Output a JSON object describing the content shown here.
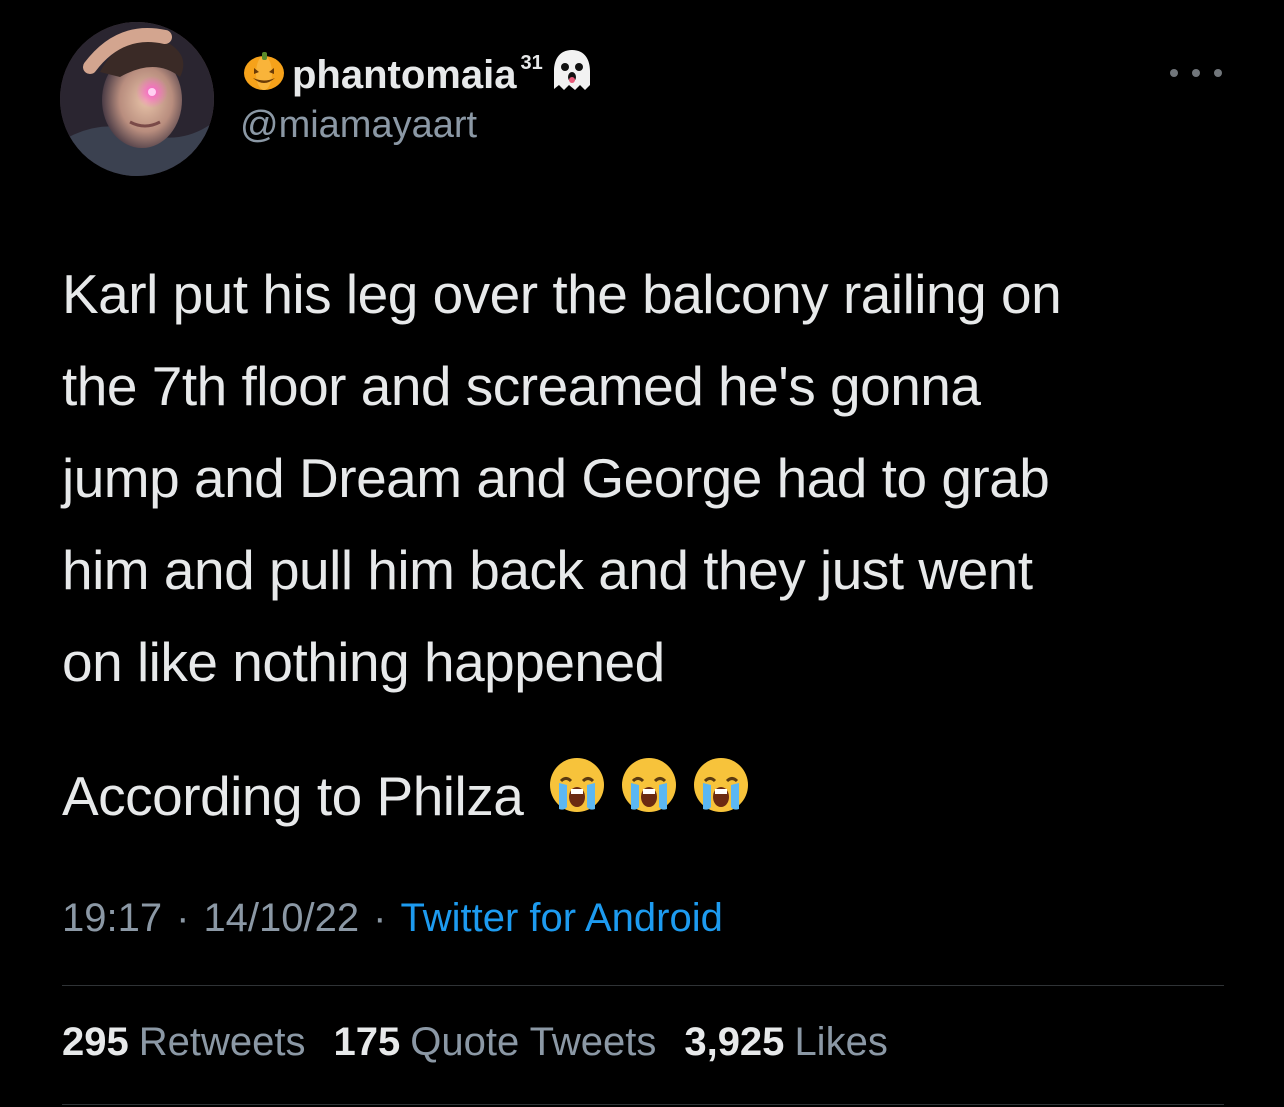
{
  "user": {
    "display_name": "phantomaia",
    "display_name_sup": "31",
    "handle": "@miamayaart",
    "name_prefix_icon": "pumpkin-icon",
    "name_suffix_icon": "ghost-icon"
  },
  "tweet": {
    "text_lines": [
      "Karl put his leg over the balcony railing on",
      "the 7th floor and screamed he's gonna",
      "jump and Dream and George had to grab",
      "him and pull him back and they just went",
      "on like nothing happened"
    ],
    "second_paragraph": "According to Philza",
    "emoji_icons": [
      "crying-face-icon",
      "crying-face-icon",
      "crying-face-icon"
    ]
  },
  "meta": {
    "time": "19:17",
    "date": "14/10/22",
    "separator": "·",
    "source": "Twitter for Android"
  },
  "stats": {
    "retweets_count": "295",
    "retweets_label": "Retweets",
    "quotes_count": "175",
    "quotes_label": "Quote Tweets",
    "likes_count": "3,925",
    "likes_label": "Likes"
  },
  "colors": {
    "background": "#000000",
    "text": "#e7e9ea",
    "secondary": "#8b98a5",
    "link": "#1d9bf0",
    "divider": "#2f3336"
  }
}
